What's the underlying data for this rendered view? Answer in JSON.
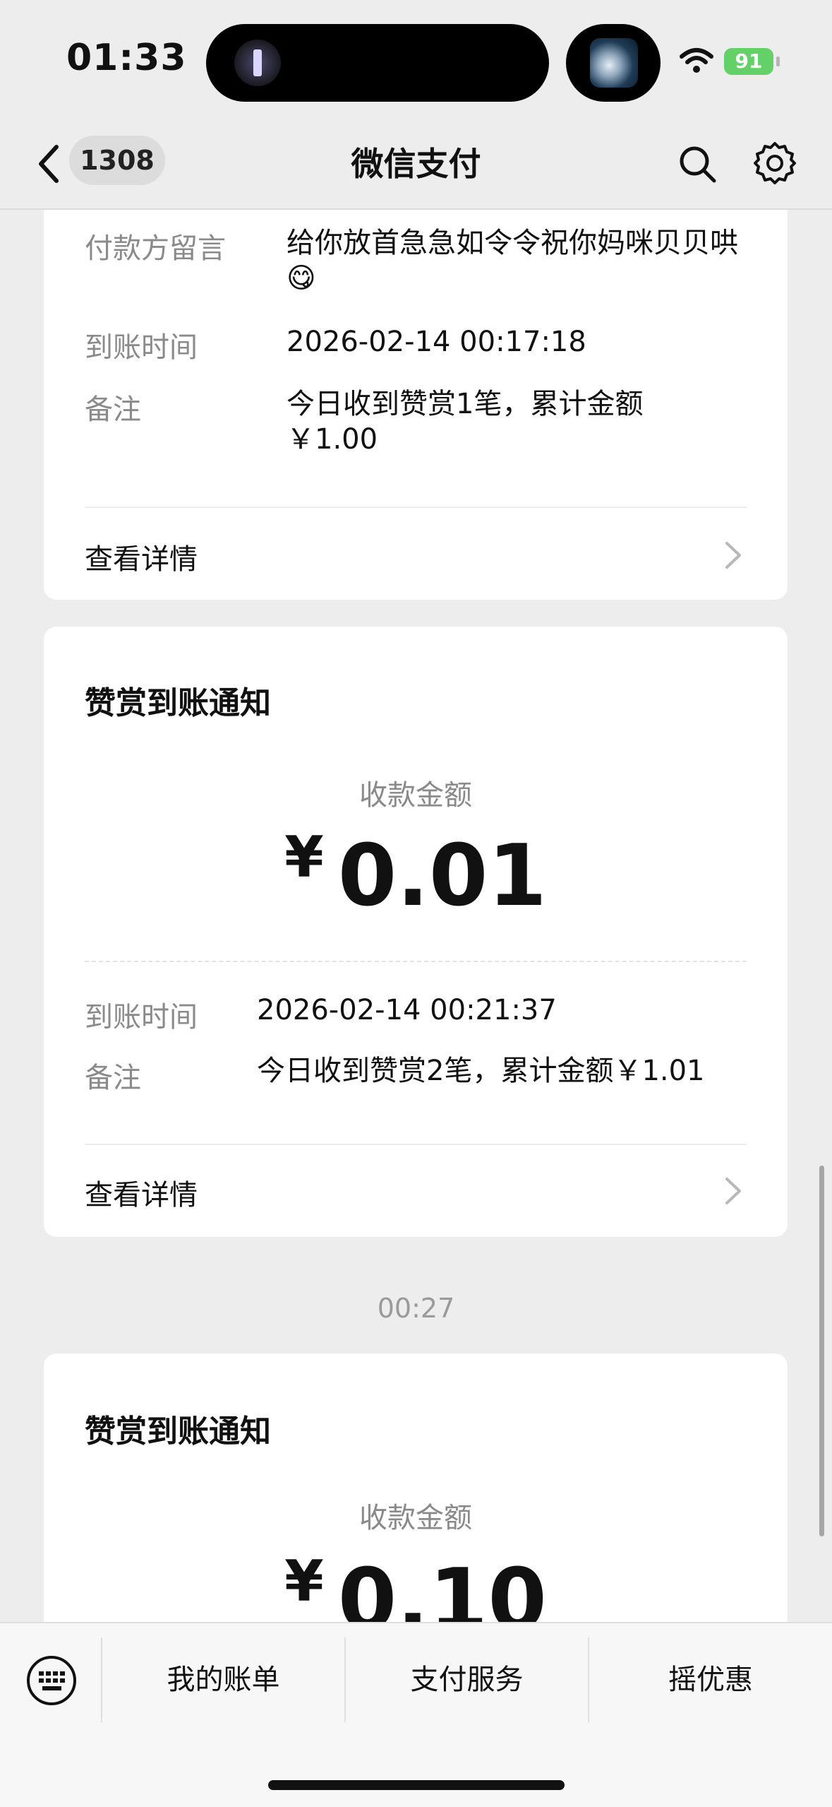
{
  "status_bar": {
    "time": "01:33",
    "battery": "91"
  },
  "nav": {
    "back_count": "1308",
    "title": "微信支付"
  },
  "card1": {
    "rows": [
      {
        "label": "付款方留言",
        "value": "给你放首急急如令令祝你妈咪贝贝哄😋"
      },
      {
        "label": "到账时间",
        "value": "2026-02-14 00:17:18"
      },
      {
        "label": "备注",
        "value": "今日收到赞赏1笔，累计金额 ￥1.00"
      }
    ],
    "link": "查看详情"
  },
  "card2": {
    "title": "赞赏到账通知",
    "amount_label": "收款金额",
    "currency": "¥",
    "amount": "0.01",
    "rows": [
      {
        "label": "到账时间",
        "value": "2026-02-14 00:21:37"
      },
      {
        "label": "备注",
        "value": "今日收到赞赏2笔，累计金额￥1.01"
      }
    ],
    "link": "查看详情"
  },
  "timestamp": "00:27",
  "card3": {
    "title": "赞赏到账通知",
    "amount_label": "收款金额",
    "currency": "¥",
    "amount": "0.10"
  },
  "bottom_menu": {
    "items": [
      "我的账单",
      "支付服务",
      "摇优惠"
    ]
  },
  "icons": {
    "back": "chevron-left-icon",
    "search": "search-icon",
    "settings": "gear-icon",
    "keyboard": "keyboard-icon",
    "chevron": "chevron-right-icon",
    "wifi": "wifi-icon"
  },
  "colors": {
    "battery": "#63d068",
    "background": "#ededed"
  }
}
